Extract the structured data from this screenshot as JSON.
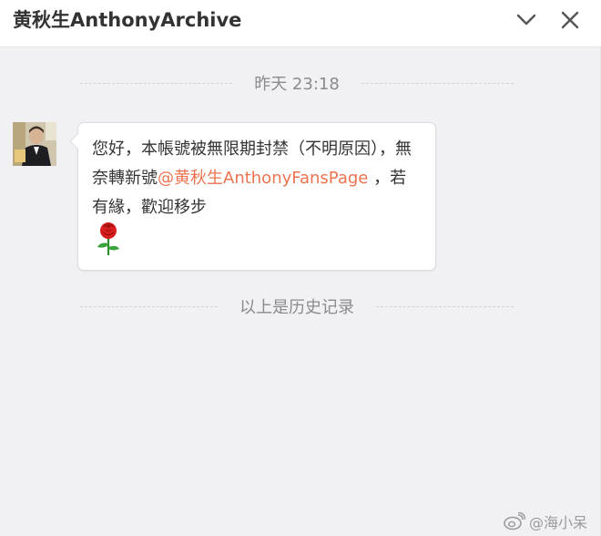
{
  "window": {
    "title": "黄秋生AnthonyArchive",
    "collapse_icon": "chevron-down-icon",
    "close_icon": "close-icon"
  },
  "conversation": {
    "timestamp": "昨天 23:18",
    "message": {
      "text_before": "您好，本帳號被無限期封禁（不明原因），無奈轉新號",
      "mention": "@黄秋生AnthonyFansPage",
      "text_after": " ，若有緣，歡迎移步",
      "emoji": "rose-icon"
    },
    "history_label": "以上是历史记录"
  },
  "watermark": {
    "icon": "weibo-logo",
    "text": "@海小呆"
  },
  "colors": {
    "background": "#f1f1f4",
    "mention": "#eb7350",
    "text": "#333333",
    "muted": "#8a8a8f"
  }
}
